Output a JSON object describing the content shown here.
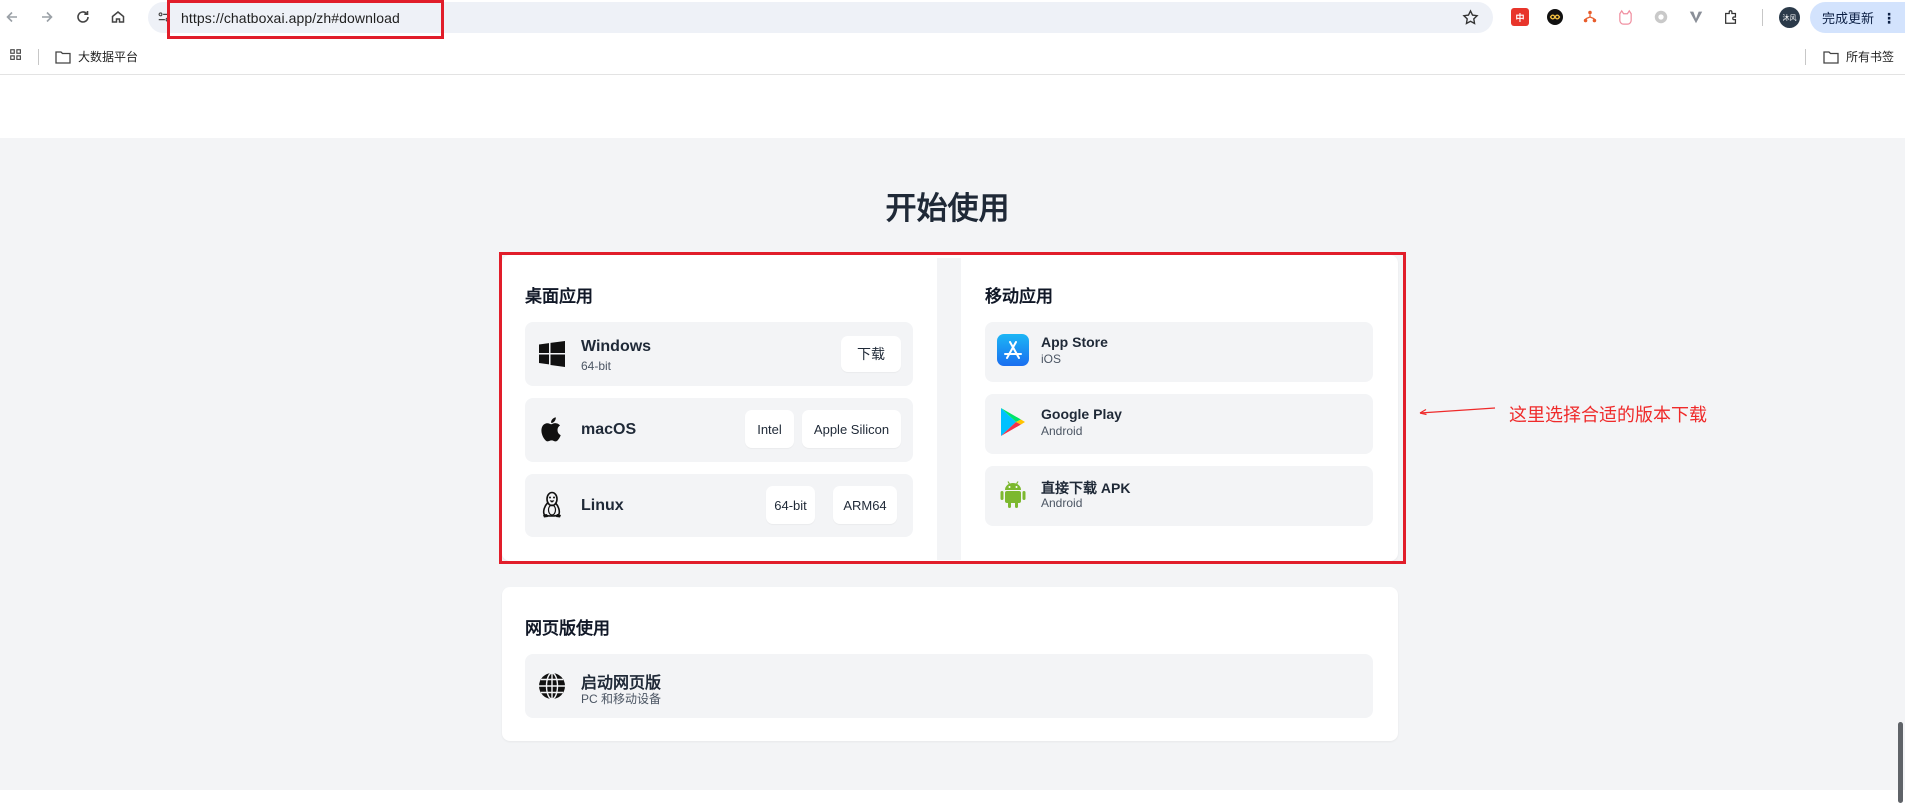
{
  "browser": {
    "url": "https://chatboxai.app/zh#download",
    "update_button": "完成更新",
    "avatar_text": "沐风",
    "bookmarks": {
      "folder1": "大数据平台",
      "all_bookmarks": "所有书签"
    }
  },
  "page": {
    "heading": "开始使用",
    "desktop": {
      "title": "桌面应用",
      "windows": {
        "name": "Windows",
        "sub": "64-bit",
        "button": "下载"
      },
      "macos": {
        "name": "macOS",
        "buttons": [
          "Intel",
          "Apple Silicon"
        ]
      },
      "linux": {
        "name": "Linux",
        "buttons": [
          "64-bit",
          "ARM64"
        ]
      }
    },
    "mobile": {
      "title": "移动应用",
      "items": [
        {
          "name": "App Store",
          "sub": "iOS",
          "icon": "app-store-icon"
        },
        {
          "name": "Google Play",
          "sub": "Android",
          "icon": "google-play-icon"
        },
        {
          "name": "直接下载 APK",
          "sub": "Android",
          "icon": "android-icon"
        }
      ]
    },
    "web": {
      "title": "网页版使用",
      "item": {
        "name": "启动网页版",
        "sub": "PC 和移动设备"
      }
    }
  },
  "annotation": {
    "text": "这里选择合适的版本下载",
    "color": "#ef2a2a"
  },
  "colors": {
    "highlight": "#e11d2a",
    "page_bg": "#f3f4f6",
    "card_bg": "#ffffff",
    "row_bg": "#f3f4f6"
  }
}
